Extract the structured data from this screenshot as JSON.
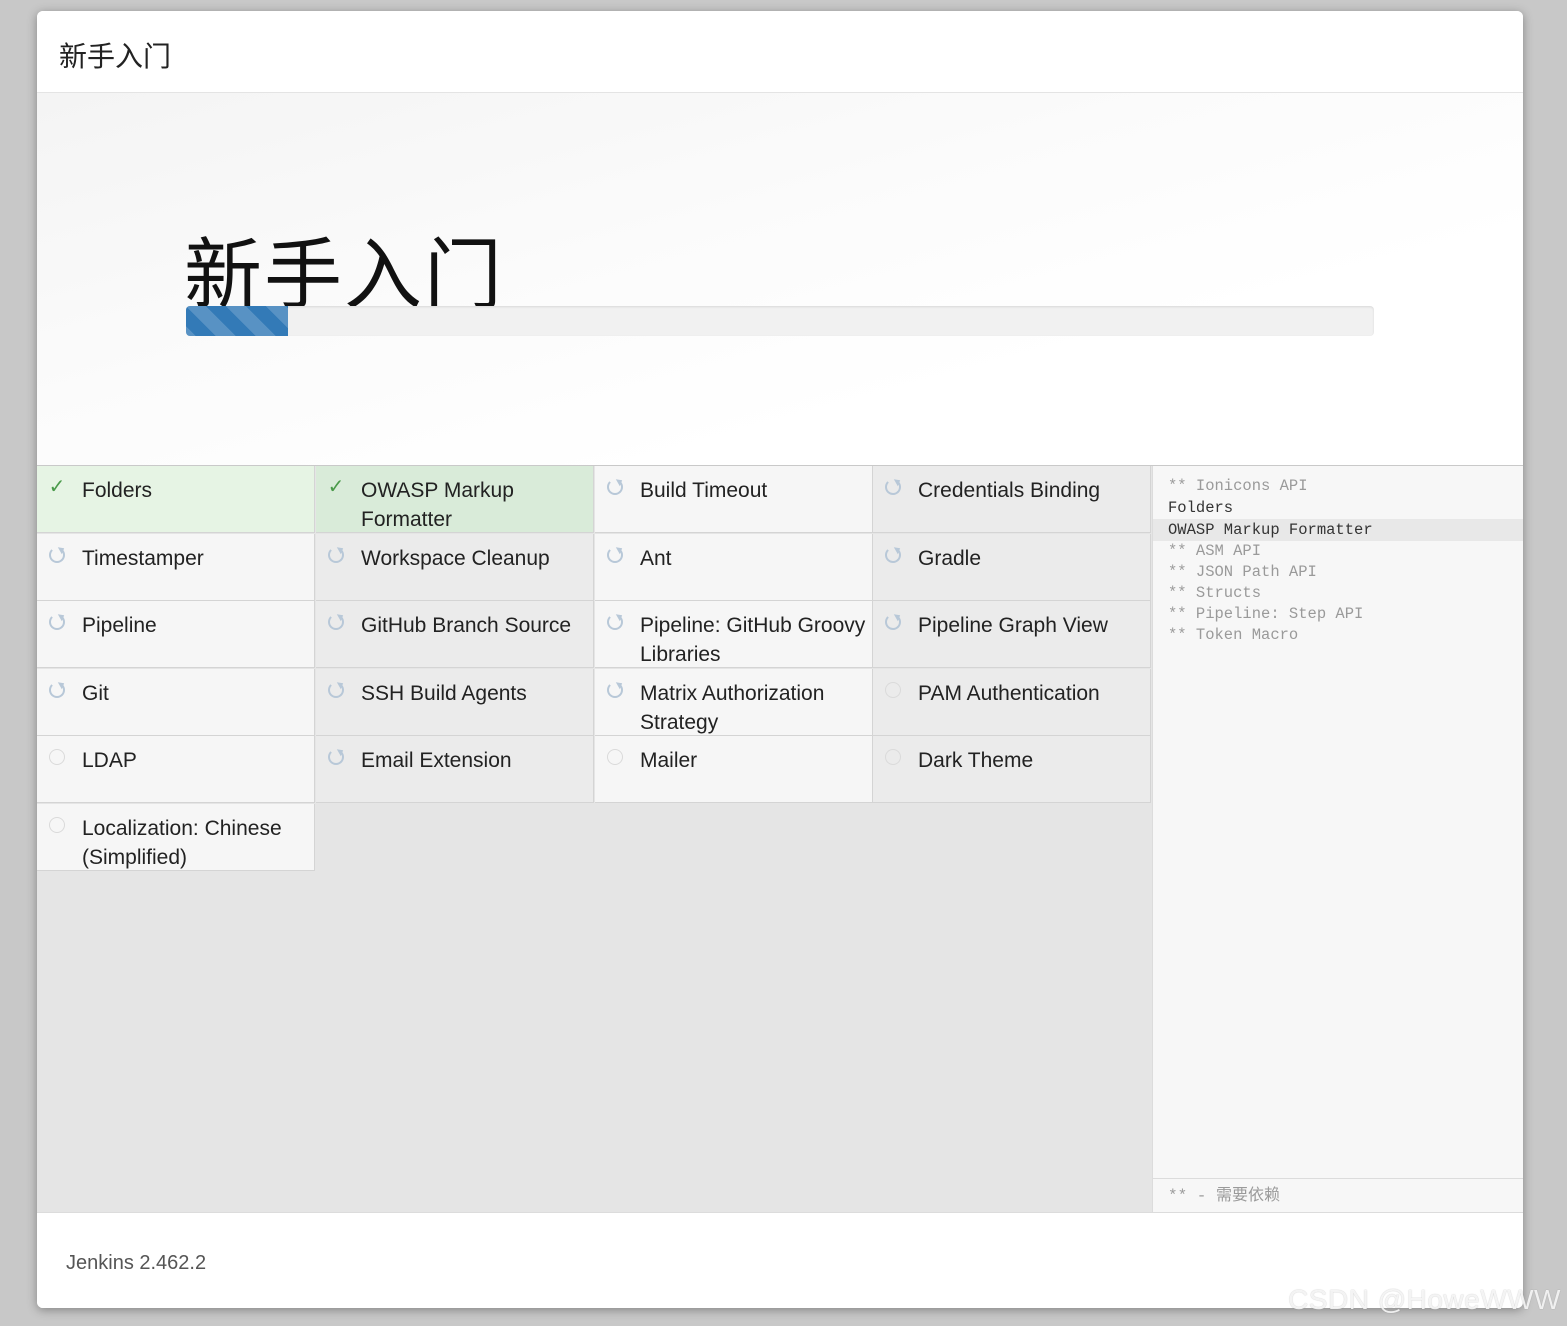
{
  "header": {
    "title": "新手入门"
  },
  "hero": {
    "title": "新手入门",
    "progress_percent": 8.6
  },
  "plugins": [
    {
      "name": "Folders",
      "status": "success"
    },
    {
      "name": "OWASP Markup Formatter",
      "status": "success"
    },
    {
      "name": "Build Timeout",
      "status": "installing"
    },
    {
      "name": "Credentials Binding",
      "status": "installing"
    },
    {
      "name": "Timestamper",
      "status": "installing"
    },
    {
      "name": "Workspace Cleanup",
      "status": "installing"
    },
    {
      "name": "Ant",
      "status": "installing"
    },
    {
      "name": "Gradle",
      "status": "installing"
    },
    {
      "name": "Pipeline",
      "status": "installing"
    },
    {
      "name": "GitHub Branch Source",
      "status": "installing"
    },
    {
      "name": "Pipeline: GitHub Groovy Libraries",
      "status": "installing"
    },
    {
      "name": "Pipeline Graph View",
      "status": "installing"
    },
    {
      "name": "Git",
      "status": "installing"
    },
    {
      "name": "SSH Build Agents",
      "status": "installing"
    },
    {
      "name": "Matrix Authorization Strategy",
      "status": "installing"
    },
    {
      "name": "PAM Authentication",
      "status": "pending"
    },
    {
      "name": "LDAP",
      "status": "pending"
    },
    {
      "name": "Email Extension",
      "status": "installing"
    },
    {
      "name": "Mailer",
      "status": "pending"
    },
    {
      "name": "Dark Theme",
      "status": "pending"
    },
    {
      "name": "Localization: Chinese (Simplified)",
      "status": "pending"
    }
  ],
  "log": {
    "lines": [
      {
        "text": "** Ionicons API",
        "kind": "dep"
      },
      {
        "text": "Folders",
        "kind": "done"
      },
      {
        "text": "OWASP Markup Formatter",
        "kind": "current"
      },
      {
        "text": "** ASM API",
        "kind": "dep"
      },
      {
        "text": "** JSON Path API",
        "kind": "dep"
      },
      {
        "text": "** Structs",
        "kind": "dep"
      },
      {
        "text": "** Pipeline: Step API",
        "kind": "dep"
      },
      {
        "text": "** Token Macro",
        "kind": "dep"
      }
    ],
    "legend": "** - 需要依赖"
  },
  "footer": {
    "version": "Jenkins 2.462.2"
  },
  "watermark": "CSDN @HoweWWW",
  "colors": {
    "accent": "#337ab7",
    "success_bg": "#d9ebd9",
    "success_icon": "#4a9a4a"
  },
  "icons": {
    "success": "check-icon",
    "installing": "refresh-spinner-icon",
    "pending": "empty-circle-icon"
  }
}
